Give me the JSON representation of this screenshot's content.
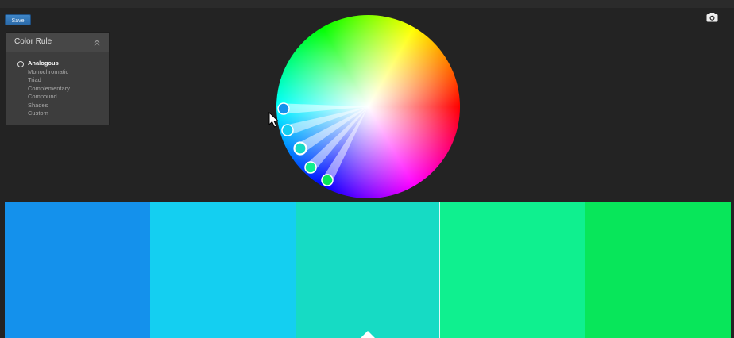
{
  "toolbar": {
    "save_label": "Save"
  },
  "panel": {
    "title": "Color Rule",
    "rules": [
      {
        "label": "Analogous",
        "selected": true
      },
      {
        "label": "Monochromatic",
        "selected": false
      },
      {
        "label": "Triad",
        "selected": false
      },
      {
        "label": "Complementary",
        "selected": false
      },
      {
        "label": "Compound",
        "selected": false
      },
      {
        "label": "Shades",
        "selected": false
      },
      {
        "label": "Custom",
        "selected": false
      }
    ]
  },
  "icons": {
    "camera": "camera-icon",
    "collapse": "chevron-double-up-icon",
    "cursor": "mouse-pointer-icon"
  },
  "swatches": [
    {
      "color": "#1491ec",
      "active": false
    },
    {
      "color": "#14cff1",
      "active": false
    },
    {
      "color": "#16dbc4",
      "active": true
    },
    {
      "color": "#0ff08f",
      "active": false
    },
    {
      "color": "#08e65a",
      "active": false
    }
  ],
  "colors": {
    "background": "#232323",
    "panel": "#3d3d3d",
    "accent": "#2c6aa8"
  }
}
